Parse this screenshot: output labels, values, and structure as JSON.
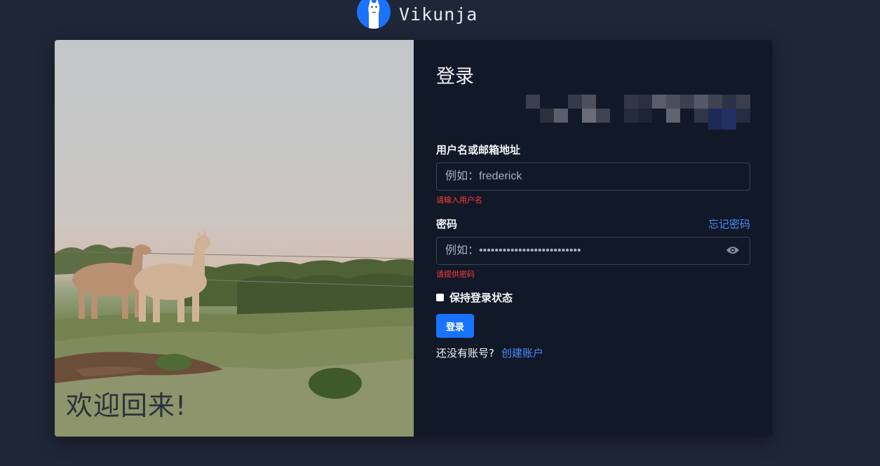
{
  "brand": {
    "name": "Vikunja",
    "logo_icon": "llama-logo-icon",
    "logo_color": "#1973ff"
  },
  "photo": {
    "welcome_text": "欢迎回来!"
  },
  "form": {
    "title": "登录",
    "username": {
      "label": "用户名或邮箱地址",
      "placeholder": "例如：frederick",
      "error": "请输入用户名"
    },
    "password": {
      "label": "密码",
      "forgot_link": "忘记密码",
      "placeholder": "例如：••••••••••••••••••••••••••",
      "error": "请提供密码",
      "toggle_icon": "eye-icon"
    },
    "remember": {
      "label": "保持登录状态"
    },
    "submit_label": "登录",
    "signup": {
      "prompt": "还没有账号?",
      "link": "创建账户"
    }
  },
  "colors": {
    "background": "#1f2637",
    "card": "#111827",
    "accent": "#1973ff",
    "link": "#4a8cff",
    "error": "#ff3b3b"
  }
}
